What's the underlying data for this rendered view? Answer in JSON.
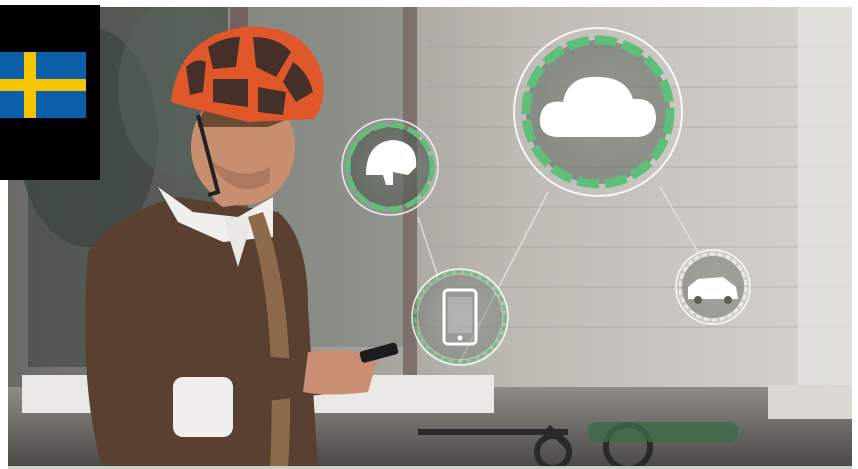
{
  "video": {
    "title": "",
    "description": ""
  },
  "overlay": {
    "language_flag": "Sweden",
    "flag_colors": {
      "blue": "#0a5fa8",
      "yellow": "#f5c400"
    }
  },
  "connected_icons": [
    {
      "name": "helmet-icon"
    },
    {
      "name": "cloud-icon"
    },
    {
      "name": "smartphone-icon"
    },
    {
      "name": "car-icon"
    }
  ],
  "colors": {
    "ring_green": "#5fbf7a",
    "helmet_orange": "#e0582a",
    "sweater_brown": "#5a4030"
  }
}
